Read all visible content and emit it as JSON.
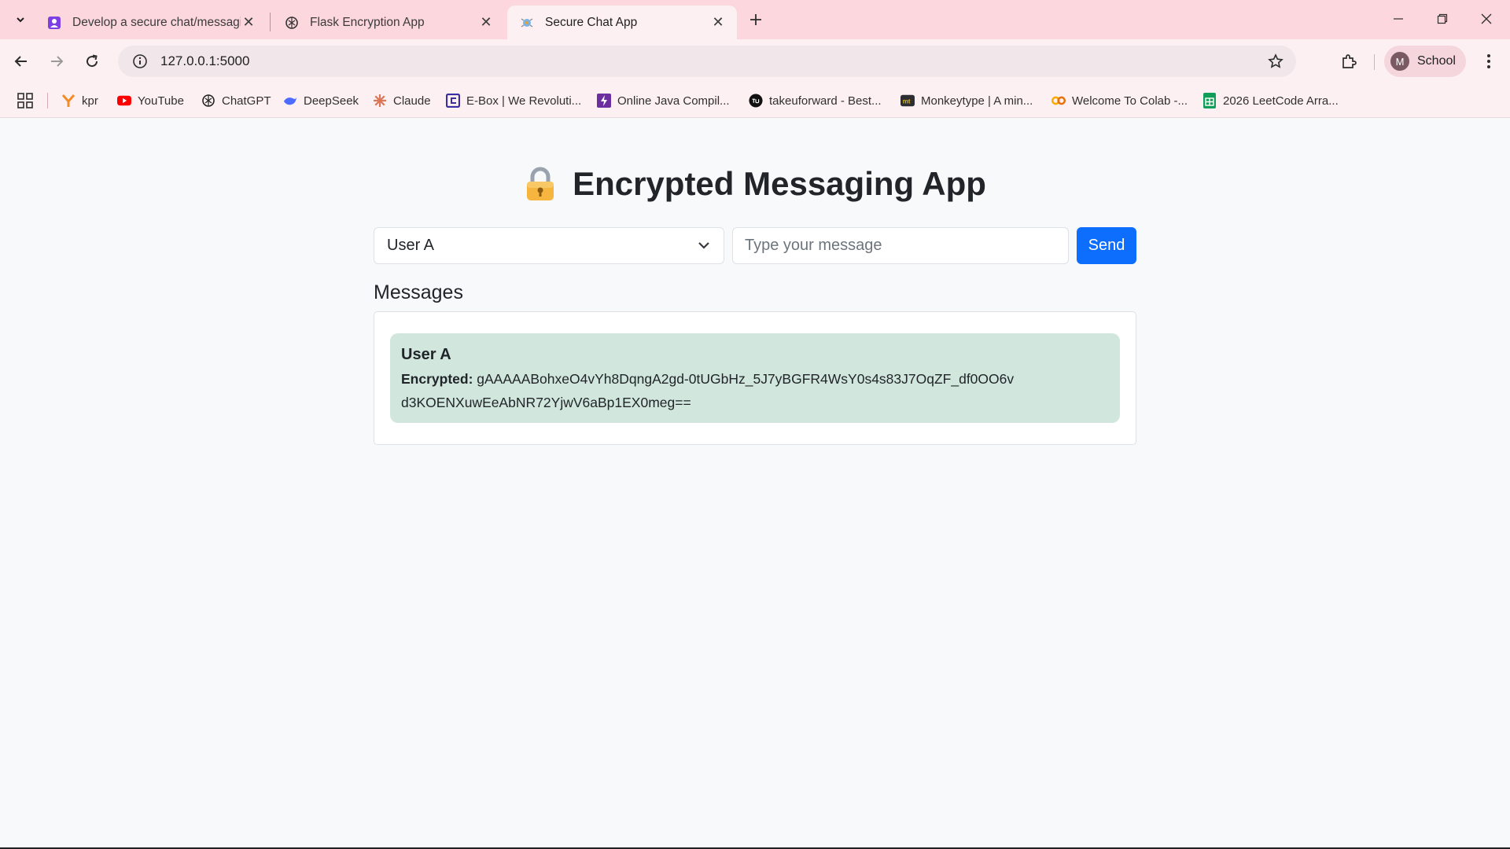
{
  "browser": {
    "tabs": [
      {
        "title": "Develop a secure chat/messaging",
        "active": false
      },
      {
        "title": "Flask Encryption App",
        "active": false
      },
      {
        "title": "Secure Chat App",
        "active": true
      }
    ],
    "address": "127.0.0.1:5000",
    "profile": {
      "initial": "M",
      "name": "School"
    },
    "bookmarks": [
      {
        "label": "kpr",
        "icon": "kpr-icon",
        "color": "#f28c28"
      },
      {
        "label": "YouTube",
        "icon": "youtube-icon",
        "color": "#ff0000"
      },
      {
        "label": "ChatGPT",
        "icon": "chatgpt-icon",
        "color": "#222222"
      },
      {
        "label": "DeepSeek",
        "icon": "deepseek-icon",
        "color": "#4d6bfe"
      },
      {
        "label": "Claude",
        "icon": "claude-icon",
        "color": "#d97757"
      },
      {
        "label": "E-Box | We Revoluti...",
        "icon": "ebox-icon",
        "color": "#3b2fa0"
      },
      {
        "label": "Online Java Compil...",
        "icon": "java-compiler-icon",
        "color": "#6b2fa0"
      },
      {
        "label": "takeuforward - Best...",
        "icon": "tuf-icon",
        "color": "#111111"
      },
      {
        "label": "Monkeytype | A min...",
        "icon": "monkeytype-icon",
        "color": "#e2b714"
      },
      {
        "label": "Welcome To Colab -...",
        "icon": "colab-icon",
        "color": "#f9ab00"
      },
      {
        "label": "2026 LeetCode Arra...",
        "icon": "sheets-icon",
        "color": "#0f9d58"
      }
    ]
  },
  "app": {
    "title": "Encrypted Messaging App",
    "title_icon": "lock-icon",
    "selected_user": "User A",
    "message_placeholder": "Type your message",
    "send_label": "Send",
    "messages_heading": "Messages",
    "messages": [
      {
        "user": "User A",
        "encrypted_label": "Encrypted:",
        "encrypted_value": "gAAAAABohxeO4vYh8DqngA2gd-0tUGbHz_5J7yBGFR4WsY0s4s83J7OqZF_df0OO6vd3KOENXuwEeAbNR72YjwV6aBp1EX0meg=="
      }
    ]
  },
  "colors": {
    "tab_strip": "#fcd7de",
    "toolbar": "#fdf0f3",
    "accent_button": "#0d6efd",
    "message_card": "#d1e7dd"
  }
}
